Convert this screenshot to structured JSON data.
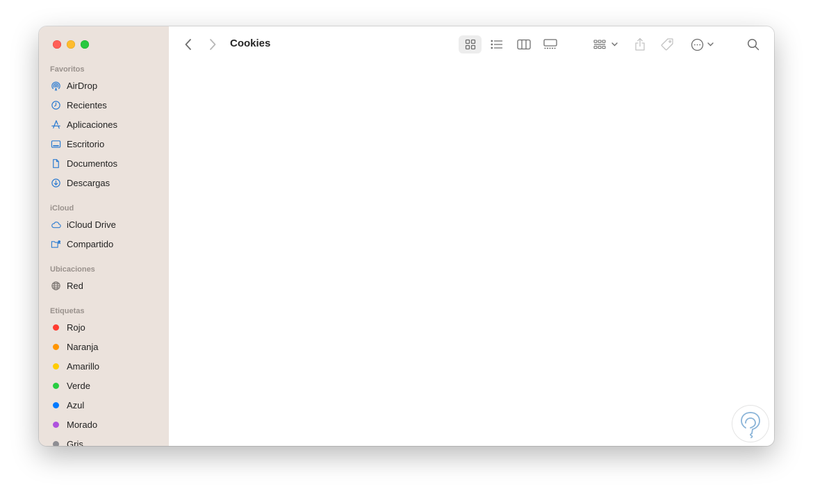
{
  "window": {
    "title": "Cookies"
  },
  "sidebar": {
    "sections": [
      {
        "title": "Favoritos",
        "items": [
          {
            "label": "AirDrop",
            "icon": "airdrop-icon"
          },
          {
            "label": "Recientes",
            "icon": "clock-icon"
          },
          {
            "label": "Aplicaciones",
            "icon": "apps-icon"
          },
          {
            "label": "Escritorio",
            "icon": "desktop-icon"
          },
          {
            "label": "Documentos",
            "icon": "document-icon"
          },
          {
            "label": "Descargas",
            "icon": "download-icon"
          }
        ]
      },
      {
        "title": "iCloud",
        "items": [
          {
            "label": "iCloud Drive",
            "icon": "cloud-icon"
          },
          {
            "label": "Compartido",
            "icon": "shared-folder-icon"
          }
        ]
      },
      {
        "title": "Ubicaciones",
        "items": [
          {
            "label": "Red",
            "icon": "globe-icon"
          }
        ]
      },
      {
        "title": "Etiquetas",
        "items": [
          {
            "label": "Rojo",
            "color": "#ff3b30"
          },
          {
            "label": "Naranja",
            "color": "#ff9500"
          },
          {
            "label": "Amarillo",
            "color": "#ffcc00"
          },
          {
            "label": "Verde",
            "color": "#28cd41"
          },
          {
            "label": "Azul",
            "color": "#007aff"
          },
          {
            "label": "Morado",
            "color": "#af52de"
          },
          {
            "label": "Gris",
            "color": "#8e8e93"
          }
        ]
      }
    ]
  },
  "colors": {
    "accent": "#2f7dd1",
    "sidebar_bg": "#ebe2dc"
  }
}
